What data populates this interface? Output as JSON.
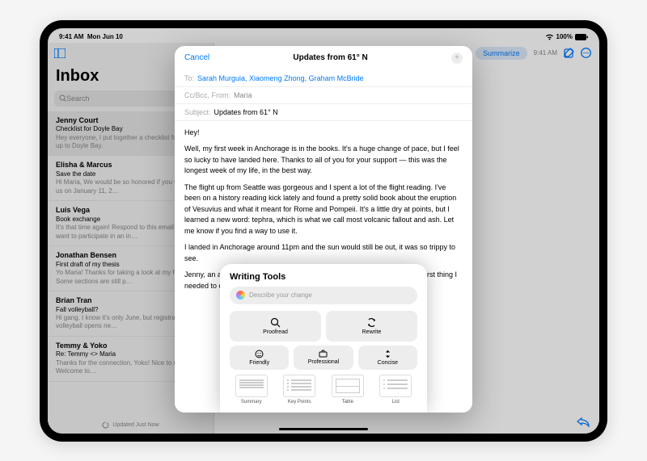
{
  "status": {
    "time": "9:41 AM",
    "date": "Mon Jun 10",
    "battery": "100%"
  },
  "sidebar": {
    "title": "Inbox",
    "search_placeholder": "Search",
    "bottom": "Updated Just Now",
    "messages": [
      {
        "from": "Jenny Court",
        "subj": "Checklist for Doyle Bay",
        "prev": "Hey everyone, I put together a checklist for our trip up to Doyle Bay."
      },
      {
        "from": "Elisha & Marcus",
        "subj": "Save the date",
        "prev": "Hi Maria, We would be so honored if you would join us on January 11, 2…"
      },
      {
        "from": "Luis Vega",
        "subj": "Book exchange",
        "prev": "It's that time again! Respond to this email if you want to participate in an in…"
      },
      {
        "from": "Jonathan Bensen",
        "subj": "First draft of my thesis",
        "prev": "Yo Maria! Thanks for taking a look at my first draft. Some sections are still p…"
      },
      {
        "from": "Brian Tran",
        "subj": "Fall volleyball?",
        "prev": "Hi gang, I know it's only June, but registration for fall volleyball opens ne…"
      },
      {
        "from": "Temmy & Yoko",
        "subj": "Re: Temmy <> Maria",
        "prev": "Thanks for the connection, Yoko! Nice to meet you Welcome to…"
      }
    ]
  },
  "toolbar": {
    "summarize": "Summarize",
    "time": "9:41 AM"
  },
  "compose": {
    "cancel": "Cancel",
    "title": "Updates from 61° N",
    "to_label": "To:",
    "recipients": "Sarah Murguia, Xiaomeng Zhong, Graham McBride",
    "cc_label": "Cc/Bcc, From:",
    "from": "Maria",
    "subject_label": "Subject:",
    "subject": "Updates from 61° N",
    "body_greeting": "Hey!",
    "body_p1": "Well, my first week in Anchorage is in the books. It's a huge change of pace, but I feel so lucky to have landed here. Thanks to all of you for your support — this was the longest week of my life, in the best way.",
    "body_p2": "The flight up from Seattle was gorgeous and I spent a lot of the flight reading. I've been on a history reading kick lately and found a pretty solid book about the eruption of Vesuvius and what it meant for Rome and Pompeii. It's a little dry at points, but I learned a new word: tephra, which is what we call most volcanic fallout and ash. Let me know if you find a way to use it.",
    "body_p3": "I landed in Anchorage around 11pm and the sun would still be out, it was so trippy to see.",
    "body_p4": "Jenny, an assistant professor here, met me at the airport. She told me the first thing I needed to do was actually sleeping for the few hours it actua…"
  },
  "tools": {
    "title": "Writing Tools",
    "placeholder": "Describe your change",
    "proofread": "Proofread",
    "rewrite": "Rewrite",
    "friendly": "Friendly",
    "professional": "Professional",
    "concise": "Concise",
    "summary": "Summary",
    "keypoints": "Key Points",
    "table": "Table",
    "list": "List"
  }
}
